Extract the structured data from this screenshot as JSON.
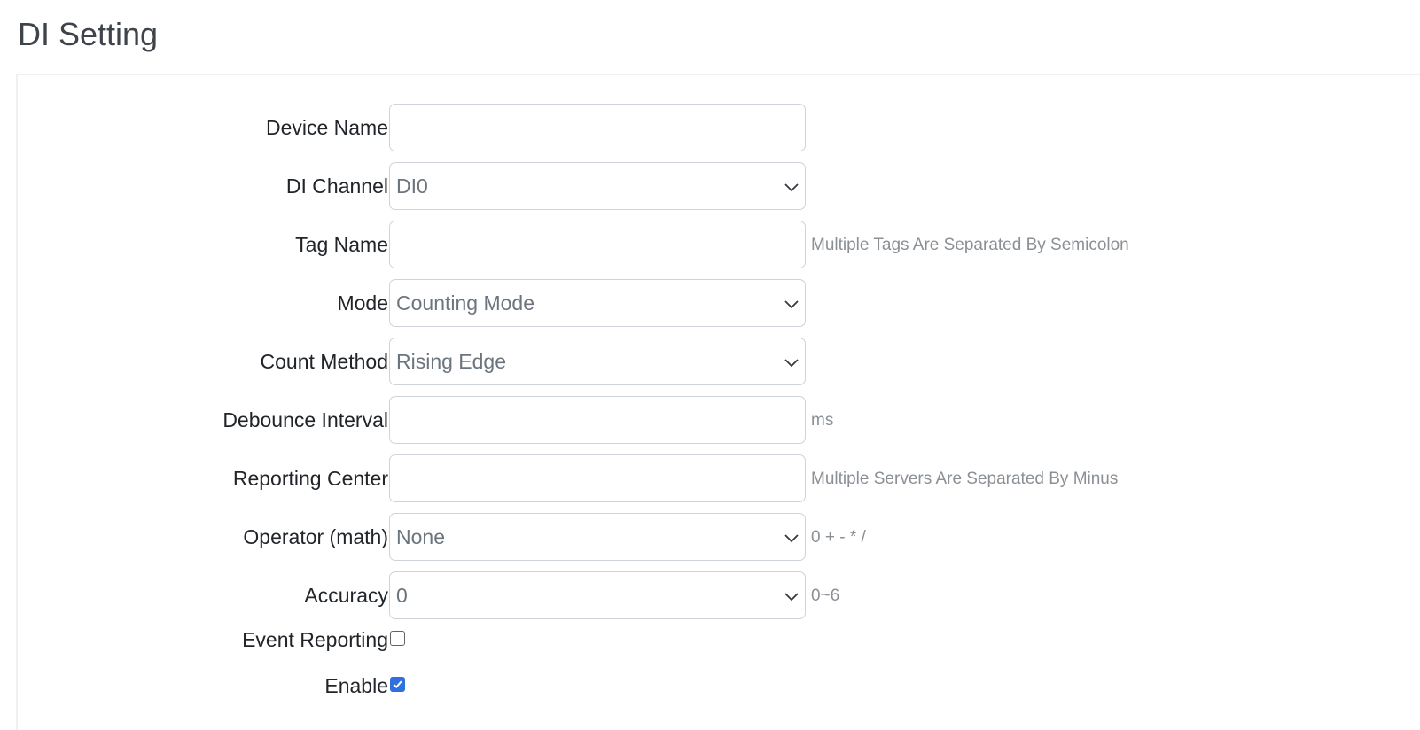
{
  "page": {
    "title": "DI Setting"
  },
  "form": {
    "device_name": {
      "label": "Device Name",
      "value": ""
    },
    "di_channel": {
      "label": "DI Channel",
      "value": "DI0"
    },
    "tag_name": {
      "label": "Tag Name",
      "value": "",
      "hint": "Multiple Tags Are Separated By Semicolon"
    },
    "mode": {
      "label": "Mode",
      "value": "Counting Mode"
    },
    "count_method": {
      "label": "Count Method",
      "value": "Rising Edge"
    },
    "debounce_interval": {
      "label": "Debounce Interval",
      "value": "",
      "hint": "ms"
    },
    "reporting_center": {
      "label": "Reporting Center",
      "value": "",
      "hint": "Multiple Servers Are Separated By Minus"
    },
    "operator": {
      "label": "Operator (math)",
      "value": "None",
      "hint": "0 + - * /"
    },
    "accuracy": {
      "label": "Accuracy",
      "value": "0",
      "hint": "0~6"
    },
    "event_reporting": {
      "label": "Event Reporting",
      "checked": false
    },
    "enable": {
      "label": "Enable",
      "checked": true
    }
  },
  "icons": {
    "select_arrow": "chevron-down-icon",
    "check_mark": "checkmark-icon"
  },
  "colors": {
    "accent": "#2f6fde",
    "border": "#ced4da",
    "hint": "#8a9096"
  }
}
